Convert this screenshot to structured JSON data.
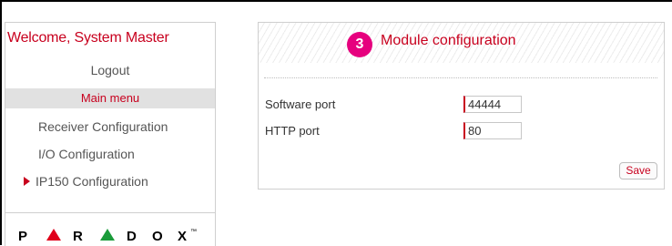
{
  "sidebar": {
    "welcome": "Welcome, System Master",
    "logout": "Logout",
    "menu_header": "Main menu",
    "items": [
      {
        "label": "Receiver Configuration",
        "active": false
      },
      {
        "label": "I/O Configuration",
        "active": false
      },
      {
        "label": "IP150 Configuration",
        "active": true
      }
    ],
    "logo": {
      "letters": [
        "P",
        "R",
        "D",
        "O",
        "X"
      ],
      "trademark": "™",
      "colors": {
        "red_triangle": "#e0001b",
        "green_triangle": "#1a9b3a",
        "text": "#000000"
      }
    }
  },
  "panel": {
    "step_number": "3",
    "title": "Module configuration",
    "fields": [
      {
        "label": "Software port",
        "value": "44444"
      },
      {
        "label": "HTTP port",
        "value": "80"
      }
    ],
    "save_label": "Save"
  },
  "colors": {
    "accent_red": "#c8001e",
    "step_badge": "#e6007e",
    "menu_header_bg": "#e1e1e1"
  },
  "icons": {
    "active_item": "triangle-right-icon"
  }
}
